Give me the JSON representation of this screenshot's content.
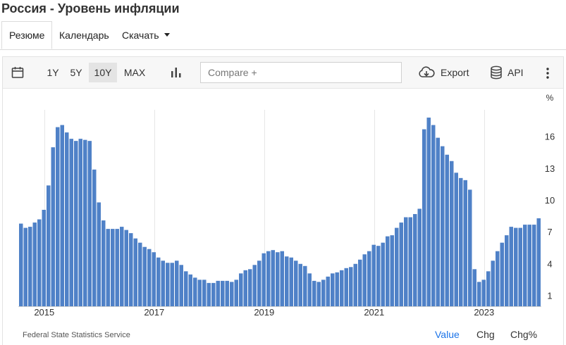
{
  "page": {
    "title": "Россия - Уровень инфляции"
  },
  "tabs": [
    {
      "label": "Резюме",
      "active": true
    },
    {
      "label": "Календарь",
      "active": false
    },
    {
      "label": "Скачать",
      "active": false
    }
  ],
  "toolbar": {
    "ranges": [
      "1Y",
      "5Y",
      "10Y",
      "MAX"
    ],
    "selected_range": "10Y",
    "compare_placeholder": "Compare +",
    "export_label": "Export",
    "api_label": "API",
    "icons": [
      "calendar-icon",
      "bar-chart-icon",
      "cloud-download-icon",
      "database-icon",
      "more-vertical-icon"
    ]
  },
  "footer": {
    "source": "Federal State Statistics Service",
    "modes": [
      "Value",
      "Chg",
      "Chg%"
    ],
    "selected_mode": "Value"
  },
  "colors": {
    "bar": "#4f81c7",
    "accent": "#1a73e8"
  },
  "chart_data": {
    "type": "bar",
    "y_unit": "%",
    "ylim": [
      0,
      18.4
    ],
    "yticks": [
      1,
      4,
      7,
      10,
      13,
      16
    ],
    "x_ticks": [
      "2015",
      "2017",
      "2019",
      "2021",
      "2023"
    ],
    "x_tick_index": [
      5,
      29,
      53,
      77,
      101
    ],
    "grid": "vertical",
    "legend": "none",
    "values": [
      7.8,
      7.4,
      7.5,
      7.9,
      8.2,
      9.1,
      11.4,
      15.0,
      16.9,
      17.1,
      16.4,
      15.8,
      15.6,
      15.8,
      15.7,
      15.6,
      12.9,
      9.8,
      8.1,
      7.3,
      7.3,
      7.3,
      7.5,
      7.2,
      6.9,
      6.4,
      6.0,
      5.6,
      5.4,
      5.1,
      4.6,
      4.3,
      4.1,
      4.1,
      4.3,
      3.9,
      3.3,
      3.0,
      2.7,
      2.5,
      2.5,
      2.2,
      2.2,
      2.4,
      2.4,
      2.4,
      2.3,
      2.5,
      3.1,
      3.4,
      3.5,
      3.9,
      4.3,
      5.0,
      5.2,
      5.3,
      5.1,
      5.2,
      4.7,
      4.6,
      4.3,
      4.0,
      3.8,
      3.1,
      2.4,
      2.3,
      2.5,
      2.8,
      3.1,
      3.2,
      3.4,
      3.6,
      3.7,
      4.0,
      4.4,
      4.9,
      5.2,
      5.8,
      5.7,
      6.0,
      6.6,
      6.7,
      7.4,
      7.9,
      8.4,
      8.4,
      8.7,
      9.2,
      16.7,
      17.8,
      17.1,
      15.9,
      15.1,
      14.3,
      13.7,
      12.6,
      12.1,
      11.9,
      11.0,
      3.5,
      2.3,
      2.5,
      3.3,
      4.3,
      5.2,
      6.0,
      6.7,
      7.5,
      7.4,
      7.4,
      7.7,
      7.7,
      7.7,
      8.3
    ]
  }
}
